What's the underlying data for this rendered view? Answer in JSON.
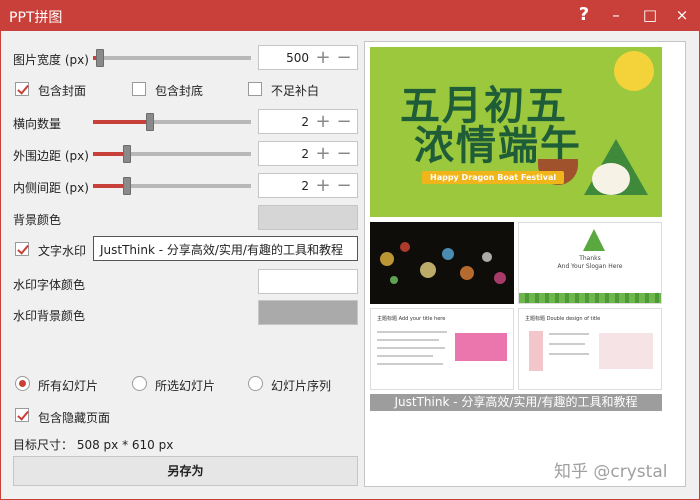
{
  "window": {
    "title": "PPT拼图",
    "help_label": "?",
    "min_label": "–",
    "max_label": "□",
    "close_label": "×"
  },
  "settings": {
    "image_width": {
      "label": "图片宽度 (px)",
      "value": "500",
      "level": 0.02
    },
    "include_cover": {
      "label": "包含封面",
      "checked": true
    },
    "include_back": {
      "label": "包含封底",
      "checked": false
    },
    "fill_missing": {
      "label": "不足补白",
      "checked": false
    },
    "columns": {
      "label": "横向数量",
      "value": "2",
      "level": 0.35
    },
    "outer_margin": {
      "label": "外围边距 (px)",
      "value": "2",
      "level": 0.2
    },
    "inner_spacing": {
      "label": "内侧间距 (px)",
      "value": "2",
      "level": 0.2
    },
    "bg_color": {
      "label": "背景颜色",
      "color": "#d6d6d6"
    },
    "text_watermark": {
      "label": "文字水印",
      "checked": true,
      "value": "JustThink - 分享高效/实用/有趣的工具和教程"
    },
    "wm_font_color": {
      "label": "水印字体颜色",
      "color": "#ffffff"
    },
    "wm_bg_color": {
      "label": "水印背景颜色",
      "color": "#aaaaaa"
    },
    "scope": {
      "all": "所有幻灯片",
      "selected": "所选幻灯片",
      "sequence": "幻灯片序列",
      "checked": "all"
    },
    "include_hidden": {
      "label": "包含隐藏页面",
      "checked": true
    },
    "target_size": "目标尺寸： 508 px * 610 px",
    "save_label": "另存为"
  },
  "preview": {
    "main_title_1": "五月初五",
    "main_title_2": "浓情端午",
    "banner": "Happy Dragon Boat Festival",
    "thanks_1": "Thanks",
    "thanks_2": "And Your Slogan Here",
    "doc1_heading": "主题标题 Add your title here",
    "doc2_heading": "主题标题 Double design of title",
    "watermark": "JustThink - 分享高效/实用/有趣的工具和教程"
  },
  "overlay_watermark": "知乎 @crystal",
  "colors": {
    "accent": "#c9403a",
    "slider_track": "#b8b8b8",
    "titlebar": "#c9403a"
  }
}
